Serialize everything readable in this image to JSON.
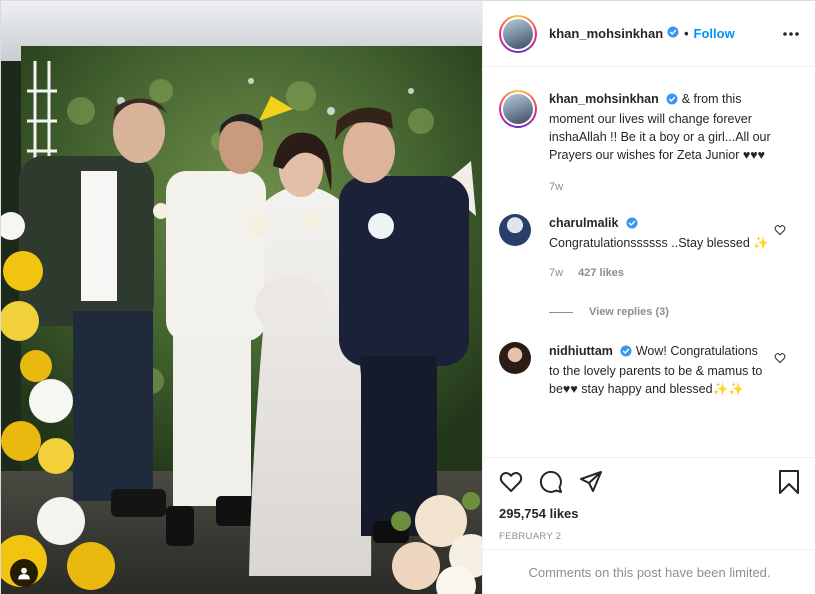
{
  "post": {
    "author": "khan_mohsinkhan",
    "follow_label": "Follow",
    "separator": "•",
    "caption_author": "khan_mohsinkhan",
    "caption_text": "& from this moment our lives will change forever inshaAllah !! Be it a boy or a girl...All our Prayers our wishes for Zeta Junior ♥♥♥",
    "caption_time": "7w",
    "likes": "295,754 likes",
    "date": "FEBRUARY 2",
    "comments_limited": "Comments on this post have been limited."
  },
  "comments": [
    {
      "author": "charulmalik",
      "text": "Congratulationssssss ..Stay blessed ✨",
      "time": "7w",
      "likes": "427 likes",
      "view_replies": "View replies (3)"
    },
    {
      "author": "nidhiuttam",
      "text": "Wow! Congratulations to the lovely parents to be & mamus to be♥♥ stay happy and blessed✨✨"
    }
  ],
  "icons": {
    "verified": "verified-badge-icon",
    "more": "more-options-icon",
    "like": "heart-icon",
    "comment": "comment-icon",
    "share": "share-icon",
    "save": "bookmark-icon",
    "tags": "user-tag-icon"
  },
  "colors": {
    "accent": "#0095f6",
    "text": "#262626",
    "muted": "#8e8e8e",
    "border": "#efefef"
  }
}
